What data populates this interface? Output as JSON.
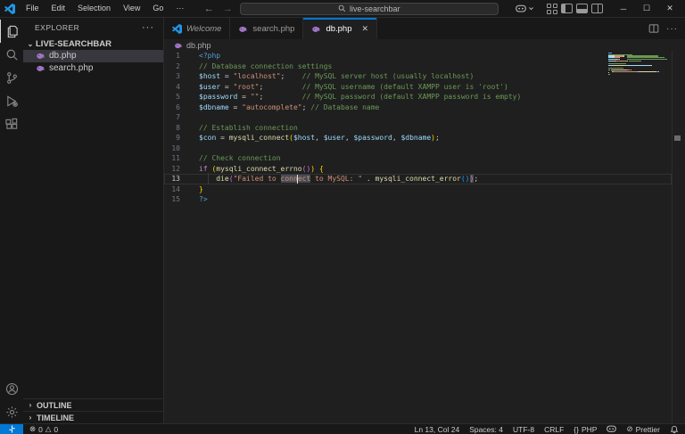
{
  "titlebar": {
    "menus": [
      "File",
      "Edit",
      "Selection",
      "View",
      "Go",
      "···"
    ],
    "back_arrow": "←",
    "forward_arrow": "→",
    "search_value": "live-searchbar",
    "window_controls": [
      "minimize",
      "maximize",
      "close"
    ]
  },
  "activity_bar": {
    "items": [
      "explorer",
      "search",
      "source-control",
      "run-debug",
      "extensions"
    ],
    "active": "explorer",
    "bottom_items": [
      "accounts",
      "settings"
    ]
  },
  "sidebar": {
    "header": "EXPLORER",
    "header_more": "···",
    "root_folder": "LIVE-SEARCHBAR",
    "files": [
      {
        "name": "db.php",
        "selected": true
      },
      {
        "name": "search.php",
        "selected": false
      }
    ],
    "sections": [
      "OUTLINE",
      "TIMELINE"
    ]
  },
  "tabs": [
    {
      "label": "Welcome",
      "icon": "vscode",
      "italic": true,
      "active": false
    },
    {
      "label": "search.php",
      "icon": "php",
      "italic": false,
      "active": false
    },
    {
      "label": "db.php",
      "icon": "php",
      "italic": false,
      "active": true,
      "close": "✕"
    }
  ],
  "breadcrumb": "db.php",
  "editor": {
    "active_line": 13,
    "colors": {
      "tag": "#569CD6",
      "cm": "#6A9955",
      "v": "#9CDCFE",
      "op": "#D4D4D4",
      "pl": "#CCCCCC",
      "s": "#CE9178",
      "fn": "#DCDCAA",
      "kw": "#C586C0",
      "b1": "#FFD700",
      "b2": "#DA70D6",
      "b3": "#179FFF"
    },
    "lines": [
      {
        "n": 1,
        "tokens": [
          {
            "t": "<?php",
            "c": "tag"
          }
        ]
      },
      {
        "n": 2,
        "tokens": [
          {
            "t": "// Database connection settings",
            "c": "cm"
          }
        ]
      },
      {
        "n": 3,
        "tokens": [
          {
            "t": "$host",
            "c": "v"
          },
          {
            "t": " = ",
            "c": "op"
          },
          {
            "t": "\"localhost\"",
            "c": "s"
          },
          {
            "t": ";",
            "c": "pl"
          },
          {
            "t": "    ",
            "c": "pl"
          },
          {
            "t": "// MySQL server host (usually localhost)",
            "c": "cm"
          }
        ]
      },
      {
        "n": 4,
        "tokens": [
          {
            "t": "$user",
            "c": "v"
          },
          {
            "t": " = ",
            "c": "op"
          },
          {
            "t": "\"root\"",
            "c": "s"
          },
          {
            "t": ";",
            "c": "pl"
          },
          {
            "t": "         ",
            "c": "pl"
          },
          {
            "t": "// MySQL username (default XAMPP user is 'root')",
            "c": "cm"
          }
        ]
      },
      {
        "n": 5,
        "tokens": [
          {
            "t": "$password",
            "c": "v"
          },
          {
            "t": " = ",
            "c": "op"
          },
          {
            "t": "\"\"",
            "c": "s"
          },
          {
            "t": ";",
            "c": "pl"
          },
          {
            "t": "         ",
            "c": "pl"
          },
          {
            "t": "// MySQL password (default XAMPP password is empty)",
            "c": "cm"
          }
        ]
      },
      {
        "n": 6,
        "tokens": [
          {
            "t": "$dbname",
            "c": "v"
          },
          {
            "t": " = ",
            "c": "op"
          },
          {
            "t": "\"autocomplete\"",
            "c": "s"
          },
          {
            "t": ";",
            "c": "pl"
          },
          {
            "t": " ",
            "c": "pl"
          },
          {
            "t": "// Database name",
            "c": "cm"
          }
        ]
      },
      {
        "n": 7,
        "tokens": []
      },
      {
        "n": 8,
        "tokens": [
          {
            "t": "// Establish connection",
            "c": "cm"
          }
        ]
      },
      {
        "n": 9,
        "tokens": [
          {
            "t": "$con",
            "c": "v"
          },
          {
            "t": " = ",
            "c": "op"
          },
          {
            "t": "mysqli_connect",
            "c": "fn"
          },
          {
            "t": "(",
            "c": "b1"
          },
          {
            "t": "$host",
            "c": "v"
          },
          {
            "t": ", ",
            "c": "pl"
          },
          {
            "t": "$user",
            "c": "v"
          },
          {
            "t": ", ",
            "c": "pl"
          },
          {
            "t": "$password",
            "c": "v"
          },
          {
            "t": ", ",
            "c": "pl"
          },
          {
            "t": "$dbname",
            "c": "v"
          },
          {
            "t": ")",
            "c": "b1"
          },
          {
            "t": ";",
            "c": "pl"
          }
        ]
      },
      {
        "n": 10,
        "tokens": []
      },
      {
        "n": 11,
        "tokens": [
          {
            "t": "// Check connection",
            "c": "cm"
          }
        ]
      },
      {
        "n": 12,
        "tokens": [
          {
            "t": "if",
            "c": "kw"
          },
          {
            "t": " ",
            "c": "pl"
          },
          {
            "t": "(",
            "c": "b1"
          },
          {
            "t": "mysqli_connect_errno",
            "c": "fn"
          },
          {
            "t": "(",
            "c": "b2"
          },
          {
            "t": ")",
            "c": "b2"
          },
          {
            "t": ")",
            "c": "b1"
          },
          {
            "t": " ",
            "c": "pl"
          },
          {
            "t": "{",
            "c": "b1"
          }
        ]
      },
      {
        "n": 13,
        "tokens": [
          {
            "t": "  ",
            "c": "pl"
          },
          {
            "t": "  ",
            "c": "pl",
            "guide": true
          },
          {
            "t": "die",
            "c": "fn"
          },
          {
            "t": "(",
            "c": "b2"
          },
          {
            "t": "\"Failed to ",
            "c": "s"
          },
          {
            "t": "conn",
            "c": "s",
            "hl": true
          },
          {
            "cursor": true
          },
          {
            "t": "ect",
            "c": "s",
            "hl": true
          },
          {
            "t": " to MySQL: \"",
            "c": "s"
          },
          {
            "t": " . ",
            "c": "pl"
          },
          {
            "t": "mysqli_connect_error",
            "c": "fn"
          },
          {
            "t": "(",
            "c": "b3"
          },
          {
            "t": ")",
            "c": "b3"
          },
          {
            "t": ")",
            "c": "b2",
            "bm": true
          },
          {
            "t": ";",
            "c": "pl"
          }
        ]
      },
      {
        "n": 14,
        "tokens": [
          {
            "t": "}",
            "c": "b1"
          }
        ]
      },
      {
        "n": 15,
        "tokens": [
          {
            "t": "?>",
            "c": "tag"
          }
        ]
      }
    ]
  },
  "status_bar": {
    "errors": "0",
    "warnings": "0",
    "error_icon": "⊗",
    "warning_icon": "△",
    "cursor_position": "Ln 13, Col 24",
    "indentation": "Spaces: 4",
    "encoding": "UTF-8",
    "eol": "CRLF",
    "language_icon": "{}",
    "language": "PHP",
    "formatter_icon": "⊘",
    "formatter": "Prettier"
  },
  "colors": {
    "accent": "#0078d4",
    "php_icon": "#A074C4",
    "vscode_blue": "#2196E8"
  }
}
